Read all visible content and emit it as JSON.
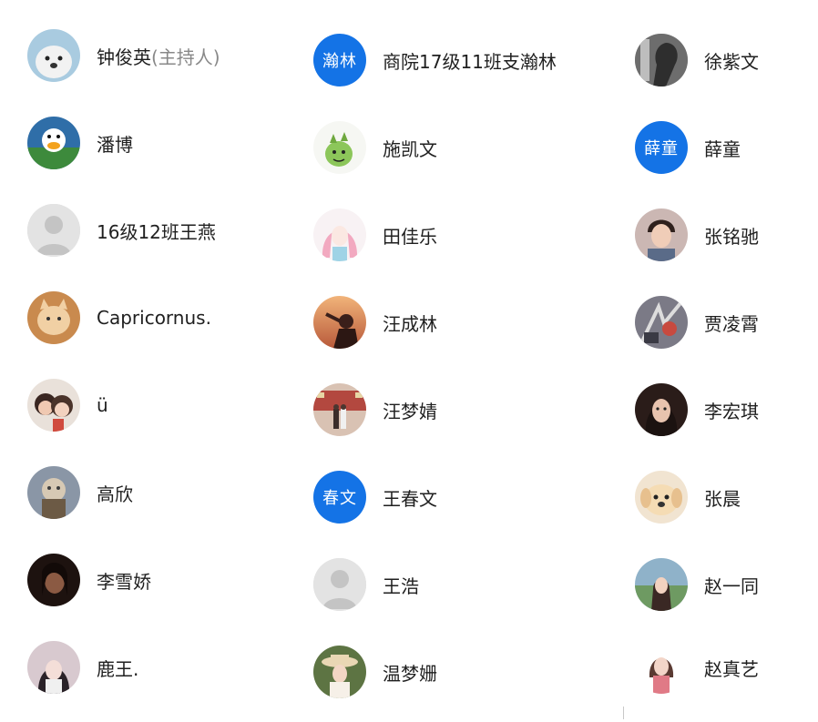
{
  "participants": {
    "columns": [
      [
        {
          "name": "钟俊英",
          "tag": "(主持人)",
          "avatar": "seal-photo",
          "bg": "#9fc3d9"
        },
        {
          "name": "潘博",
          "avatar": "donald-duck-photo",
          "bg": "#2d6a9f"
        },
        {
          "name": "16级12班王燕",
          "avatar": "default-person-icon",
          "bg": "#d9d9d9"
        },
        {
          "name": "Capricornus.",
          "avatar": "cat-photo",
          "bg": "#d9a064"
        },
        {
          "name": "ü",
          "avatar": "couple-photo",
          "bg": "#6b4d3f"
        },
        {
          "name": "高欣",
          "avatar": "sketch-photo",
          "bg": "#8d98a8"
        },
        {
          "name": "李雪娇",
          "avatar": "dark-portrait-photo",
          "bg": "#2b1a15"
        },
        {
          "name": "鹿王.",
          "avatar": "anime-girl-photo",
          "bg": "#c9b7c0"
        }
      ],
      [
        {
          "name": "商院17级11班支瀚林",
          "avatar": "text-badge",
          "badge": "瀚林",
          "bg": "#1473e6"
        },
        {
          "name": "施凯文",
          "avatar": "cactus-cartoon-photo",
          "bg": "#f2f5ef"
        },
        {
          "name": "田佳乐",
          "avatar": "pink-hair-girl-photo",
          "bg": "#f1e5ea"
        },
        {
          "name": "汪成林",
          "avatar": "sunset-silhouette-photo",
          "bg": "#e39a66"
        },
        {
          "name": "汪梦婧",
          "avatar": "street-photo",
          "bg": "#b9534a"
        },
        {
          "name": "王春文",
          "avatar": "text-badge",
          "badge": "春文",
          "bg": "#1473e6"
        },
        {
          "name": "王浩",
          "avatar": "default-person-icon",
          "bg": "#d9d9d9"
        },
        {
          "name": "温梦姗",
          "avatar": "hat-girl-photo",
          "bg": "#7a8f5a"
        }
      ],
      [
        {
          "name": "徐紫文",
          "avatar": "grayscale-photo",
          "bg": "#5d5d5d"
        },
        {
          "name": "薛童",
          "avatar": "text-badge",
          "badge": "薛童",
          "bg": "#1473e6"
        },
        {
          "name": "张铭驰",
          "avatar": "boy-portrait-photo",
          "bg": "#c7a8a0"
        },
        {
          "name": "贾凌霄",
          "avatar": "ink-art-photo",
          "bg": "#6a6a74"
        },
        {
          "name": "李宏琪",
          "avatar": "woman-portrait-photo",
          "bg": "#3b2a26"
        },
        {
          "name": "张晨",
          "avatar": "puppy-photo",
          "bg": "#e8cfa8"
        },
        {
          "name": "赵一同",
          "avatar": "outdoor-girl-photo",
          "bg": "#7fa076"
        },
        {
          "name": "赵真艺",
          "avatar": "girl-headshot-photo",
          "bg": "#f0d7d0"
        }
      ]
    ]
  }
}
